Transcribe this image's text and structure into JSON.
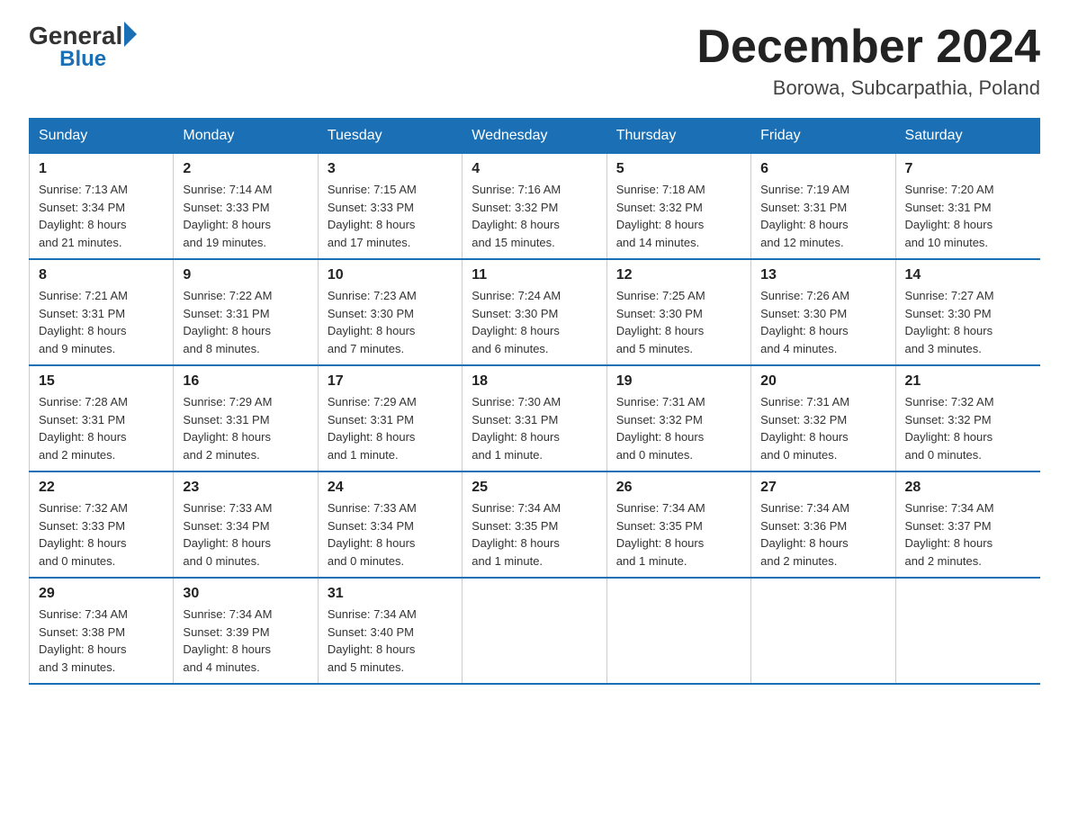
{
  "logo": {
    "general": "General",
    "arrow": "▶",
    "blue": "Blue"
  },
  "title": "December 2024",
  "subtitle": "Borowa, Subcarpathia, Poland",
  "days_of_week": [
    "Sunday",
    "Monday",
    "Tuesday",
    "Wednesday",
    "Thursday",
    "Friday",
    "Saturday"
  ],
  "weeks": [
    [
      {
        "day": "1",
        "sunrise": "7:13 AM",
        "sunset": "3:34 PM",
        "daylight": "8 hours and 21 minutes."
      },
      {
        "day": "2",
        "sunrise": "7:14 AM",
        "sunset": "3:33 PM",
        "daylight": "8 hours and 19 minutes."
      },
      {
        "day": "3",
        "sunrise": "7:15 AM",
        "sunset": "3:33 PM",
        "daylight": "8 hours and 17 minutes."
      },
      {
        "day": "4",
        "sunrise": "7:16 AM",
        "sunset": "3:32 PM",
        "daylight": "8 hours and 15 minutes."
      },
      {
        "day": "5",
        "sunrise": "7:18 AM",
        "sunset": "3:32 PM",
        "daylight": "8 hours and 14 minutes."
      },
      {
        "day": "6",
        "sunrise": "7:19 AM",
        "sunset": "3:31 PM",
        "daylight": "8 hours and 12 minutes."
      },
      {
        "day": "7",
        "sunrise": "7:20 AM",
        "sunset": "3:31 PM",
        "daylight": "8 hours and 10 minutes."
      }
    ],
    [
      {
        "day": "8",
        "sunrise": "7:21 AM",
        "sunset": "3:31 PM",
        "daylight": "8 hours and 9 minutes."
      },
      {
        "day": "9",
        "sunrise": "7:22 AM",
        "sunset": "3:31 PM",
        "daylight": "8 hours and 8 minutes."
      },
      {
        "day": "10",
        "sunrise": "7:23 AM",
        "sunset": "3:30 PM",
        "daylight": "8 hours and 7 minutes."
      },
      {
        "day": "11",
        "sunrise": "7:24 AM",
        "sunset": "3:30 PM",
        "daylight": "8 hours and 6 minutes."
      },
      {
        "day": "12",
        "sunrise": "7:25 AM",
        "sunset": "3:30 PM",
        "daylight": "8 hours and 5 minutes."
      },
      {
        "day": "13",
        "sunrise": "7:26 AM",
        "sunset": "3:30 PM",
        "daylight": "8 hours and 4 minutes."
      },
      {
        "day": "14",
        "sunrise": "7:27 AM",
        "sunset": "3:30 PM",
        "daylight": "8 hours and 3 minutes."
      }
    ],
    [
      {
        "day": "15",
        "sunrise": "7:28 AM",
        "sunset": "3:31 PM",
        "daylight": "8 hours and 2 minutes."
      },
      {
        "day": "16",
        "sunrise": "7:29 AM",
        "sunset": "3:31 PM",
        "daylight": "8 hours and 2 minutes."
      },
      {
        "day": "17",
        "sunrise": "7:29 AM",
        "sunset": "3:31 PM",
        "daylight": "8 hours and 1 minute."
      },
      {
        "day": "18",
        "sunrise": "7:30 AM",
        "sunset": "3:31 PM",
        "daylight": "8 hours and 1 minute."
      },
      {
        "day": "19",
        "sunrise": "7:31 AM",
        "sunset": "3:32 PM",
        "daylight": "8 hours and 0 minutes."
      },
      {
        "day": "20",
        "sunrise": "7:31 AM",
        "sunset": "3:32 PM",
        "daylight": "8 hours and 0 minutes."
      },
      {
        "day": "21",
        "sunrise": "7:32 AM",
        "sunset": "3:32 PM",
        "daylight": "8 hours and 0 minutes."
      }
    ],
    [
      {
        "day": "22",
        "sunrise": "7:32 AM",
        "sunset": "3:33 PM",
        "daylight": "8 hours and 0 minutes."
      },
      {
        "day": "23",
        "sunrise": "7:33 AM",
        "sunset": "3:34 PM",
        "daylight": "8 hours and 0 minutes."
      },
      {
        "day": "24",
        "sunrise": "7:33 AM",
        "sunset": "3:34 PM",
        "daylight": "8 hours and 0 minutes."
      },
      {
        "day": "25",
        "sunrise": "7:34 AM",
        "sunset": "3:35 PM",
        "daylight": "8 hours and 1 minute."
      },
      {
        "day": "26",
        "sunrise": "7:34 AM",
        "sunset": "3:35 PM",
        "daylight": "8 hours and 1 minute."
      },
      {
        "day": "27",
        "sunrise": "7:34 AM",
        "sunset": "3:36 PM",
        "daylight": "8 hours and 2 minutes."
      },
      {
        "day": "28",
        "sunrise": "7:34 AM",
        "sunset": "3:37 PM",
        "daylight": "8 hours and 2 minutes."
      }
    ],
    [
      {
        "day": "29",
        "sunrise": "7:34 AM",
        "sunset": "3:38 PM",
        "daylight": "8 hours and 3 minutes."
      },
      {
        "day": "30",
        "sunrise": "7:34 AM",
        "sunset": "3:39 PM",
        "daylight": "8 hours and 4 minutes."
      },
      {
        "day": "31",
        "sunrise": "7:34 AM",
        "sunset": "3:40 PM",
        "daylight": "8 hours and 5 minutes."
      },
      null,
      null,
      null,
      null
    ]
  ],
  "labels": {
    "sunrise": "Sunrise:",
    "sunset": "Sunset:",
    "daylight": "Daylight:"
  }
}
